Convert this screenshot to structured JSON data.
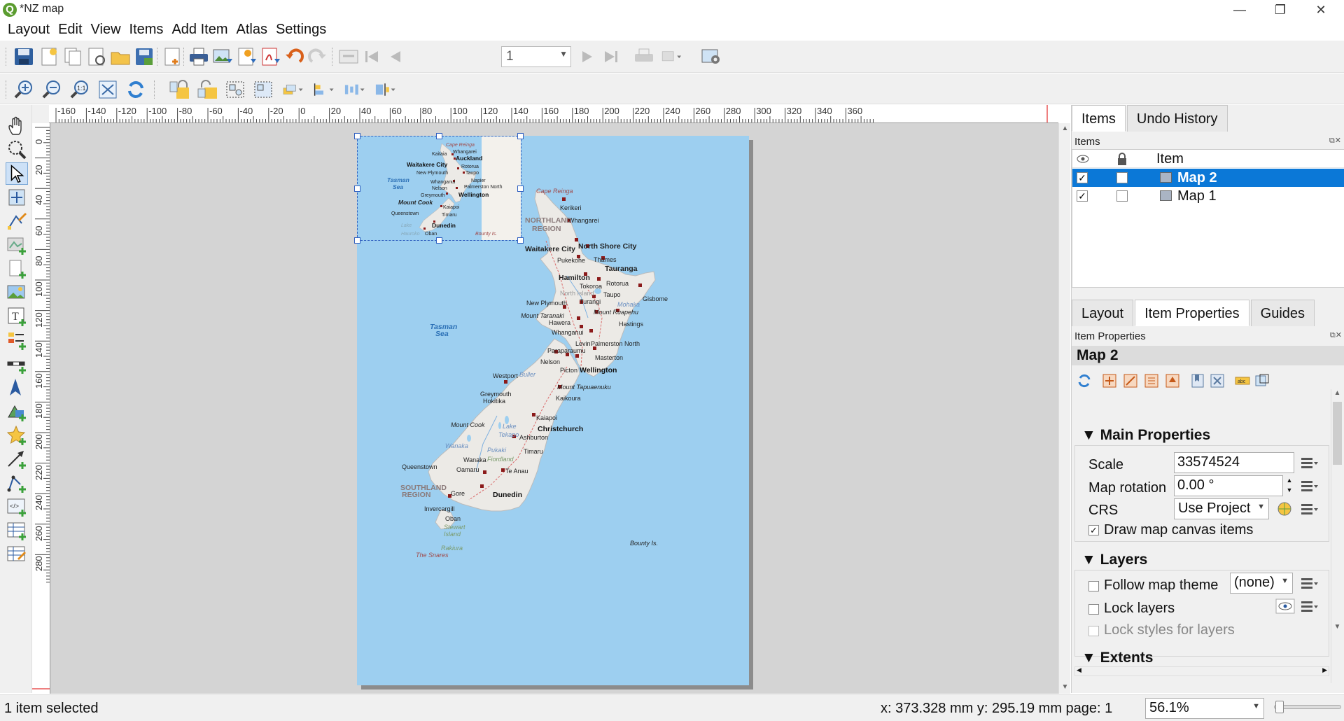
{
  "window": {
    "title": "*NZ map",
    "app_icon": "Q",
    "controls": {
      "minimize": "—",
      "restore": "❐",
      "close": "✕"
    }
  },
  "menu": [
    "Layout",
    "Edit",
    "View",
    "Items",
    "Add Item",
    "Atlas",
    "Settings"
  ],
  "toolbar": {
    "page_number": "1",
    "icons": [
      "save-icon",
      "new-layout-icon",
      "duplicate-layout-icon",
      "layout-manager-icon",
      "open-template-icon",
      "save-template-icon",
      "add-pages-icon",
      "print-icon",
      "export-image-icon",
      "export-svg-icon",
      "export-pdf-icon",
      "undo-icon",
      "redo-icon",
      "atlas-preview-icon",
      "first-feature-icon",
      "previous-feature-icon",
      "next-feature-icon",
      "last-feature-icon",
      "atlas-print-icon",
      "atlas-export-icon",
      "atlas-settings-icon"
    ]
  },
  "toolbar2_icons": [
    "zoom-in-icon",
    "zoom-out-icon",
    "zoom-100-icon",
    "zoom-full-icon",
    "refresh-icon",
    "lock-items-icon",
    "unlock-items-icon",
    "group-icon",
    "ungroup-icon",
    "raise-icon",
    "align-left-icon",
    "distribute-icon",
    "resize-icon"
  ],
  "left_tools": [
    "pan-icon",
    "zoom-tool-icon",
    "select-tool-icon",
    "move-content-icon",
    "edit-nodes-icon",
    "add-map-icon",
    "add-3d-map-icon",
    "add-picture-icon",
    "add-label-icon",
    "add-legend-icon",
    "add-scalebar-icon",
    "add-north-arrow-icon",
    "add-shape-icon",
    "add-marker-icon",
    "add-arrow-icon",
    "add-node-item-icon",
    "add-html-icon",
    "add-attribute-table-icon",
    "add-fixed-table-icon"
  ],
  "rulers": {
    "h_labels": [
      "-160",
      "-140",
      "-120",
      "-100",
      "-80",
      "-60",
      "-40",
      "-20",
      "0",
      "20",
      "40",
      "60",
      "80",
      "100",
      "120",
      "140",
      "160",
      "180",
      "200",
      "220",
      "240",
      "260",
      "280",
      "300",
      "320",
      "340",
      "360"
    ],
    "v_labels": [
      "0",
      "20",
      "40",
      "60",
      "80",
      "100",
      "120",
      "140",
      "160",
      "180",
      "200",
      "220",
      "240",
      "260",
      "280"
    ]
  },
  "map_labels": {
    "large": [
      {
        "t": "Cape Reinga",
        "c": "#a04a4a",
        "i": true
      },
      {
        "t": "Kerikeri",
        "c": "#222"
      },
      {
        "t": "Whangarei",
        "c": "#222"
      },
      {
        "t": "NORTHLAND",
        "c": "#8a7a7a",
        "b": true
      },
      {
        "t": "REGION",
        "c": "#8a7a7a",
        "b": true
      },
      {
        "t": "Waitakere City",
        "c": "#222",
        "b": true
      },
      {
        "t": "North Shore City",
        "c": "#222",
        "b": true
      },
      {
        "t": "Thames",
        "c": "#222"
      },
      {
        "t": "Pukekohe",
        "c": "#222"
      },
      {
        "t": "Tauranga",
        "c": "#222",
        "b": true
      },
      {
        "t": "Hamilton",
        "c": "#222",
        "b": true
      },
      {
        "t": "Rotorua",
        "c": "#222"
      },
      {
        "t": "Tokoroa",
        "c": "#222"
      },
      {
        "t": "Gisbome",
        "c": "#222"
      },
      {
        "t": "North Island",
        "c": "#999"
      },
      {
        "t": "Taupo",
        "c": "#222"
      },
      {
        "t": "Turangi",
        "c": "#222"
      },
      {
        "t": "New Plymouth",
        "c": "#222"
      },
      {
        "t": "Mount Ruapehu",
        "c": "#222",
        "i": true
      },
      {
        "t": "Mohaka",
        "c": "#6a8fc0",
        "i": true
      },
      {
        "t": "Mount Taranaki",
        "c": "#222",
        "i": true
      },
      {
        "t": "Hawera",
        "c": "#222"
      },
      {
        "t": "Hastings",
        "c": "#222"
      },
      {
        "t": "Tasman",
        "c": "#2a6fb5",
        "b": true,
        "i": true
      },
      {
        "t": "Sea",
        "c": "#2a6fb5",
        "b": true,
        "i": true
      },
      {
        "t": "Whanganui",
        "c": "#222"
      },
      {
        "t": "Levin",
        "c": "#222"
      },
      {
        "t": "Palmerston North",
        "c": "#222"
      },
      {
        "t": "Paraparaumu",
        "c": "#222"
      },
      {
        "t": "Masterton",
        "c": "#222"
      },
      {
        "t": "Nelson",
        "c": "#222"
      },
      {
        "t": "Picton",
        "c": "#222"
      },
      {
        "t": "Wellington",
        "c": "#111",
        "b": true
      },
      {
        "t": "Westport",
        "c": "#222"
      },
      {
        "t": "Buller",
        "c": "#6a8fc0",
        "i": true
      },
      {
        "t": "Mount Tapuaenuku",
        "c": "#222",
        "i": true
      },
      {
        "t": "Greymouth",
        "c": "#222"
      },
      {
        "t": "Hokitika",
        "c": "#222"
      },
      {
        "t": "Kaikoura",
        "c": "#222"
      },
      {
        "t": "Kaiapoi",
        "c": "#222"
      },
      {
        "t": "Mount Cook",
        "c": "#222",
        "i": true
      },
      {
        "t": "Christchurch",
        "c": "#111",
        "b": true
      },
      {
        "t": "Ashburton",
        "c": "#222"
      },
      {
        "t": "Lake",
        "c": "#6a8fc0",
        "i": true
      },
      {
        "t": "Tekapo",
        "c": "#6a8fc0",
        "i": true
      },
      {
        "t": "Pukaki",
        "c": "#6a8fc0",
        "i": true
      },
      {
        "t": "Wanaka",
        "c": "#6a8fc0",
        "i": true
      },
      {
        "t": "Timaru",
        "c": "#222"
      },
      {
        "t": "Wanaka",
        "c": "#222"
      },
      {
        "t": "Fiordland",
        "c": "#7a9a6a",
        "i": true
      },
      {
        "t": "Queenstown",
        "c": "#222"
      },
      {
        "t": "Oamaru",
        "c": "#222"
      },
      {
        "t": "Te Anau",
        "c": "#222"
      },
      {
        "t": "SOUTHLAND",
        "c": "#8a7a7a",
        "b": true
      },
      {
        "t": "REGION",
        "c": "#8a7a7a",
        "b": true
      },
      {
        "t": "Gore",
        "c": "#222"
      },
      {
        "t": "Dunedin",
        "c": "#111",
        "b": true
      },
      {
        "t": "Invercargill",
        "c": "#222"
      },
      {
        "t": "Oban",
        "c": "#222"
      },
      {
        "t": "Stewart",
        "c": "#7a9a6a",
        "i": true
      },
      {
        "t": "Island",
        "c": "#7a9a6a",
        "i": true
      },
      {
        "t": "Rakiura",
        "c": "#7a9a6a",
        "i": true
      },
      {
        "t": "The Snares",
        "c": "#a04a4a",
        "i": true
      },
      {
        "t": "Bounty Is.",
        "c": "#222",
        "i": true
      }
    ],
    "small": [
      {
        "t": "Cape Reinga",
        "c": "#a04a4a",
        "i": true
      },
      {
        "t": "Kaitaia",
        "c": "#222"
      },
      {
        "t": "Whangarei",
        "c": "#222"
      },
      {
        "t": "Auckland",
        "c": "#111",
        "b": true
      },
      {
        "t": "Waitakere City",
        "c": "#111",
        "b": true
      },
      {
        "t": "Rotorua",
        "c": "#222"
      },
      {
        "t": "New Plymouth",
        "c": "#222"
      },
      {
        "t": "Taupo",
        "c": "#222"
      },
      {
        "t": "Tasman",
        "c": "#2a6fb5",
        "b": true,
        "i": true
      },
      {
        "t": "Sea",
        "c": "#2a6fb5",
        "b": true,
        "i": true
      },
      {
        "t": "Whanganui",
        "c": "#222"
      },
      {
        "t": "Napier",
        "c": "#222"
      },
      {
        "t": "Nelson",
        "c": "#222"
      },
      {
        "t": "Palmerston North",
        "c": "#222"
      },
      {
        "t": "Greymouth",
        "c": "#222"
      },
      {
        "t": "Wellington",
        "c": "#111",
        "b": true
      },
      {
        "t": "Mount Cook",
        "c": "#222",
        "b": true,
        "i": true
      },
      {
        "t": "Kaiapoi",
        "c": "#222"
      },
      {
        "t": "Queenstown",
        "c": "#222"
      },
      {
        "t": "Timaru",
        "c": "#222"
      },
      {
        "t": "Dunedin",
        "c": "#111",
        "b": true
      },
      {
        "t": "Lake",
        "c": "#8ab",
        "i": true
      },
      {
        "t": "Hauroko",
        "c": "#8ab",
        "i": true
      },
      {
        "t": "Oban",
        "c": "#222"
      },
      {
        "t": "Bounty Is.",
        "c": "#a04a4a",
        "i": true
      }
    ]
  },
  "items_panel": {
    "tabs": [
      "Items",
      "Undo History"
    ],
    "title": "Items",
    "column_item": "Item",
    "rows": [
      {
        "name": "Map 2",
        "visible": "✓",
        "locked": "",
        "selected": true
      },
      {
        "name": "Map 1",
        "visible": "✓",
        "locked": "",
        "selected": false
      }
    ]
  },
  "props_panel": {
    "tabs": [
      "Layout",
      "Item Properties",
      "Guides"
    ],
    "title": "Item Properties",
    "item_name": "Map 2",
    "main_section": "Main Properties",
    "scale_label": "Scale",
    "scale_value": "33574524",
    "rotation_label": "Map rotation",
    "rotation_value": "0.00 °",
    "crs_label": "CRS",
    "crs_value": "Use Project",
    "draw_canvas_label": "Draw map canvas items",
    "draw_canvas_checked": "✓",
    "layers_section": "Layers",
    "follow_theme_label": "Follow map theme",
    "theme_value": "(none)",
    "lock_layers_label": "Lock layers",
    "lock_styles_label": "Lock styles for layers",
    "extents_section": "Extents"
  },
  "status": {
    "selection": "1 item selected",
    "coords": "x: 373.328 mm y: 295.19 mm page: 1",
    "zoom": "56.1%"
  },
  "colors": {
    "sea": "#9dcff0",
    "land": "#eceae6",
    "selection": "#0b78d7"
  }
}
